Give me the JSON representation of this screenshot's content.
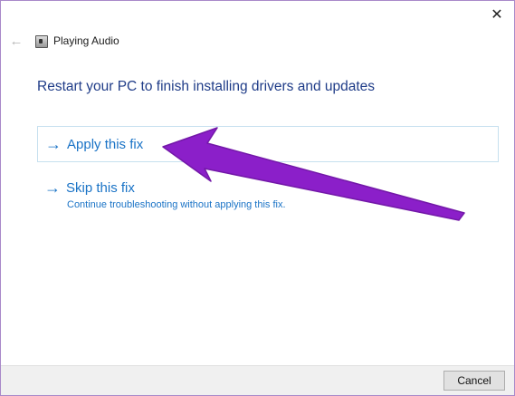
{
  "window": {
    "close_glyph": "✕",
    "back_glyph": "←",
    "title": "Playing Audio"
  },
  "main": {
    "heading": "Restart your PC to finish installing drivers and updates",
    "options": [
      {
        "arrow": "→",
        "label": "Apply this fix",
        "description": ""
      },
      {
        "arrow": "→",
        "label": "Skip this fix",
        "description": "Continue troubleshooting without applying this fix."
      }
    ]
  },
  "footer": {
    "cancel_label": "Cancel"
  },
  "colors": {
    "link_blue": "#1a73c6",
    "heading_blue": "#1f3c88",
    "annotation_purple": "#8b1fc9"
  },
  "icons": {
    "back": "back-arrow-icon",
    "close": "close-icon",
    "app": "audio-troubleshooter-icon",
    "option_arrow": "right-arrow-icon"
  }
}
